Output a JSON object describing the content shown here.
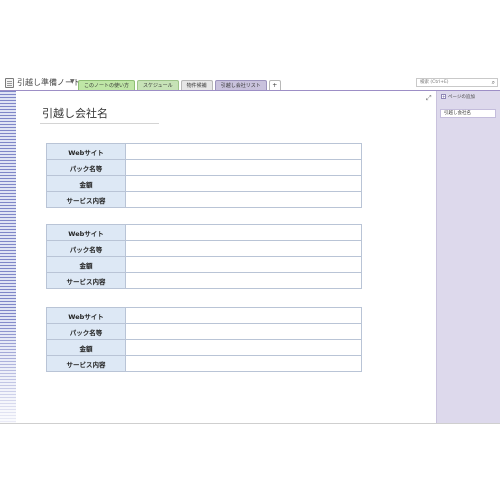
{
  "notebook": {
    "title": "引越し準備ノート"
  },
  "tabs": [
    {
      "label": "このノートの使い方"
    },
    {
      "label": "スケジュール"
    },
    {
      "label": "物件候補"
    },
    {
      "label": "引越し会社リスト"
    },
    {
      "label": "+"
    }
  ],
  "search": {
    "placeholder": "検索 (Ctrl+E)"
  },
  "page": {
    "title": "引越し会社名"
  },
  "tables": [
    {
      "rows": [
        {
          "label": "Webサイト",
          "value": ""
        },
        {
          "label": "パック名等",
          "value": ""
        },
        {
          "label": "金額",
          "value": ""
        },
        {
          "label": "サービス内容",
          "value": ""
        }
      ]
    },
    {
      "rows": [
        {
          "label": "Webサイト",
          "value": ""
        },
        {
          "label": "パック名等",
          "value": ""
        },
        {
          "label": "金額",
          "value": ""
        },
        {
          "label": "サービス内容",
          "value": ""
        }
      ]
    },
    {
      "rows": [
        {
          "label": "Webサイト",
          "value": ""
        },
        {
          "label": "パック名等",
          "value": ""
        },
        {
          "label": "金額",
          "value": ""
        },
        {
          "label": "サービス内容",
          "value": ""
        }
      ]
    }
  ],
  "right_panel": {
    "add_page_label": "ページの追加",
    "pages": [
      {
        "label": "引越し会社名"
      }
    ]
  },
  "colors": {
    "accent": "#9d8fc6",
    "label_cell_bg": "#dde8f5",
    "panel_bg": "#ddd9ec"
  }
}
